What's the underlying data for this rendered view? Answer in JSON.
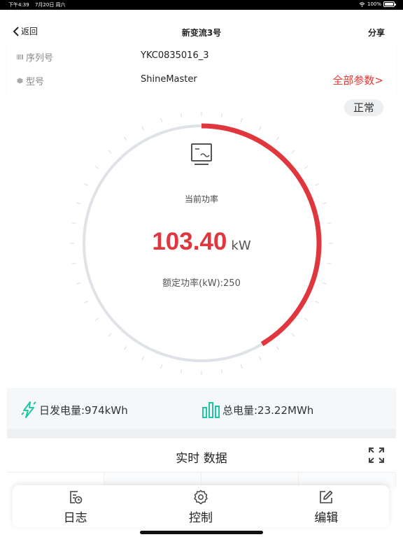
{
  "status_bar": {
    "time": "下午4:39",
    "date": "7月20日 周六",
    "battery": "100%"
  },
  "nav": {
    "back_label": "返回",
    "title": "新变流3号",
    "share_label": "分享"
  },
  "info": {
    "serial_label": "序列号",
    "serial_value": "YKC0835016_3",
    "model_label": "型号",
    "model_value": "ShineMaster",
    "all_params_link": "全部参数>"
  },
  "gauge": {
    "status_badge": "正常",
    "current_power_label": "当前功率",
    "current_power_value": "103.40",
    "power_unit": "kW",
    "rated_power_text": "额定功率(kW):250",
    "current_kw": 103.4,
    "rated_kw": 250,
    "progress_color": "#e0363e",
    "track_color": "#dfe3e8"
  },
  "energy": {
    "daily": "日发电量:974kWh",
    "total": "总电量:23.22MWh",
    "accent_color": "#1ec6a4"
  },
  "realtime": {
    "title": "实时 数据"
  },
  "toolbar": {
    "log_label": "日志",
    "control_label": "控制",
    "edit_label": "编辑"
  }
}
